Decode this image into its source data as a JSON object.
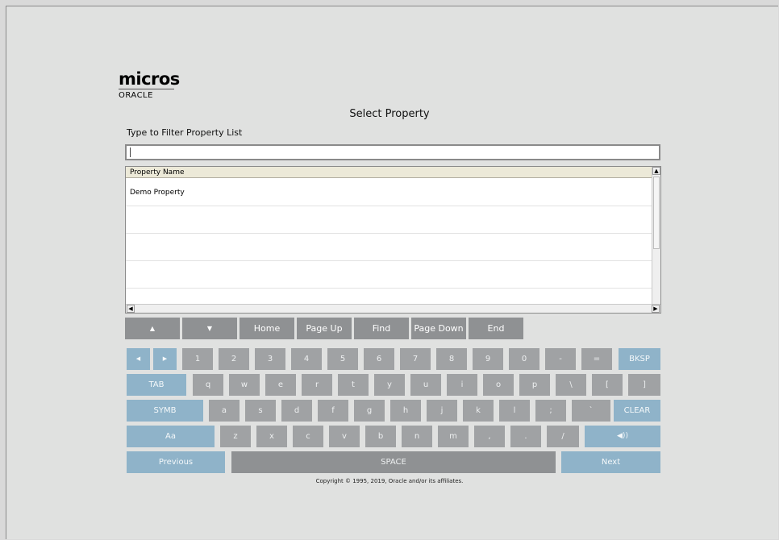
{
  "brand": {
    "line1": "micros",
    "line2": "ORACLE"
  },
  "title": "Select Property",
  "filter": {
    "label": "Type to Filter Property List",
    "value": ""
  },
  "list": {
    "header": "Property Name",
    "rows": [
      "Demo Property",
      "",
      "",
      "",
      ""
    ]
  },
  "nav_buttons": {
    "up": "▲",
    "down": "▼",
    "home": "Home",
    "page_up": "Page Up",
    "find": "Find",
    "page_down": "Page Down",
    "end": "End"
  },
  "keyboard": {
    "left": "◀",
    "right": "▶",
    "row1": [
      "1",
      "2",
      "3",
      "4",
      "5",
      "6",
      "7",
      "8",
      "9",
      "0",
      "-",
      "="
    ],
    "bksp": "BKSP",
    "tab": "TAB",
    "row2": [
      "q",
      "w",
      "e",
      "r",
      "t",
      "y",
      "u",
      "i",
      "o",
      "p",
      "\\",
      "[",
      "]"
    ],
    "symb": "SYMB",
    "row3": [
      "a",
      "s",
      "d",
      "f",
      "g",
      "h",
      "j",
      "k",
      "l",
      ";",
      "`"
    ],
    "clear": "CLEAR",
    "case": "Aa",
    "row4": [
      "z",
      "x",
      "c",
      "v",
      "b",
      "n",
      "m",
      ",",
      ".",
      "/"
    ],
    "sound": "◀))",
    "previous": "Previous",
    "space": "SPACE",
    "next": "Next"
  },
  "copyright": "Copyright © 1995, 2019, Oracle and/or its affiliates."
}
